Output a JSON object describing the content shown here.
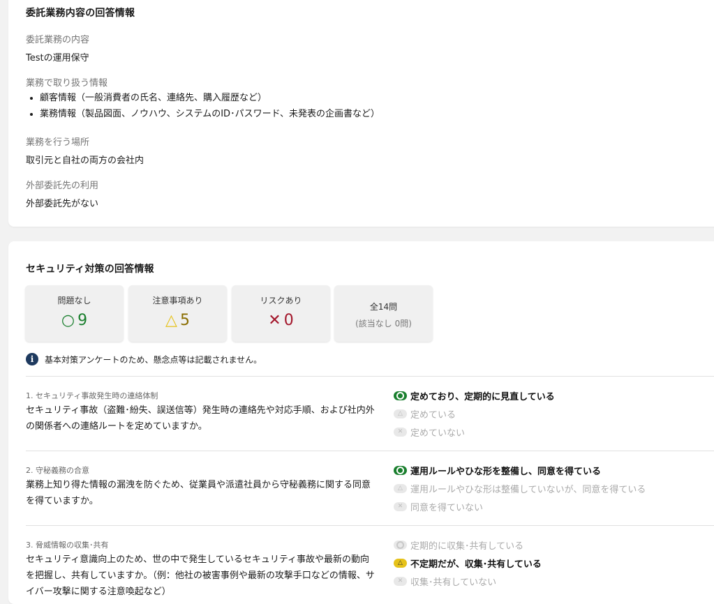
{
  "outsourcing": {
    "heading": "委託業務内容の回答情報",
    "work_label": "委託業務の内容",
    "work_value": "Testの運用保守",
    "info_label": "業務で取り扱う情報",
    "info_items": [
      "顧客情報（一般消費者の氏名、連絡先、購入履歴など）",
      "業務情報（製品図面、ノウハウ、システムのID･パスワード、未発表の企画書など）"
    ],
    "place_label": "業務を行う場所",
    "place_value": "取引元と自社の両方の会社内",
    "external_label": "外部委託先の利用",
    "external_value": "外部委託先がない"
  },
  "security": {
    "heading": "セキュリティ対策の回答情報",
    "stats": {
      "ok_label": "問題なし",
      "ok_symbol": "○",
      "ok_count": "9",
      "caution_label": "注意事項あり",
      "caution_symbol": "△",
      "caution_count": "5",
      "risk_label": "リスクあり",
      "risk_symbol": "✕",
      "risk_count": "0",
      "total_label": "全14問",
      "total_sub": "(該当なし 0問)"
    },
    "notice": "基本対策アンケートのため、懸念点等は記載されません。",
    "questions": [
      {
        "title": "1. セキュリティ事故発生時の連絡体制",
        "text": "セキュリティ事故（盗難･紛失、誤送信等）発生時の連絡先や対応手順、および社内外の関係者への連絡ルートを定めていますか。",
        "options": [
          "定めており、定期的に見直している",
          "定めている",
          "定めていない"
        ]
      },
      {
        "title": "2. 守秘義務の合意",
        "text": "業務上知り得た情報の漏洩を防ぐため、従業員や派遣社員から守秘義務に関する同意を得ていますか。",
        "options": [
          "運用ルールやひな形を整備し、同意を得ている",
          "運用ルールやひな形は整備していないが、同意を得ている",
          "同意を得ていない"
        ]
      },
      {
        "title": "3. 脅威情報の収集･共有",
        "text": "セキュリティ意識向上のため、世の中で発生しているセキュリティ事故や最新の動向を把握し、共有していますか。（例：他社の被害事例や最新の攻撃手口などの情報、サイバー攻撃に関する注意喚起など）",
        "options": [
          "定期的に収集･共有している",
          "不定期だが、収集･共有している",
          "収集･共有していない"
        ]
      }
    ]
  },
  "colors": {
    "ok": "#1a7f2e",
    "caution": "#e6c21a",
    "risk": "#a3162b",
    "info": "#1e3a5f"
  }
}
